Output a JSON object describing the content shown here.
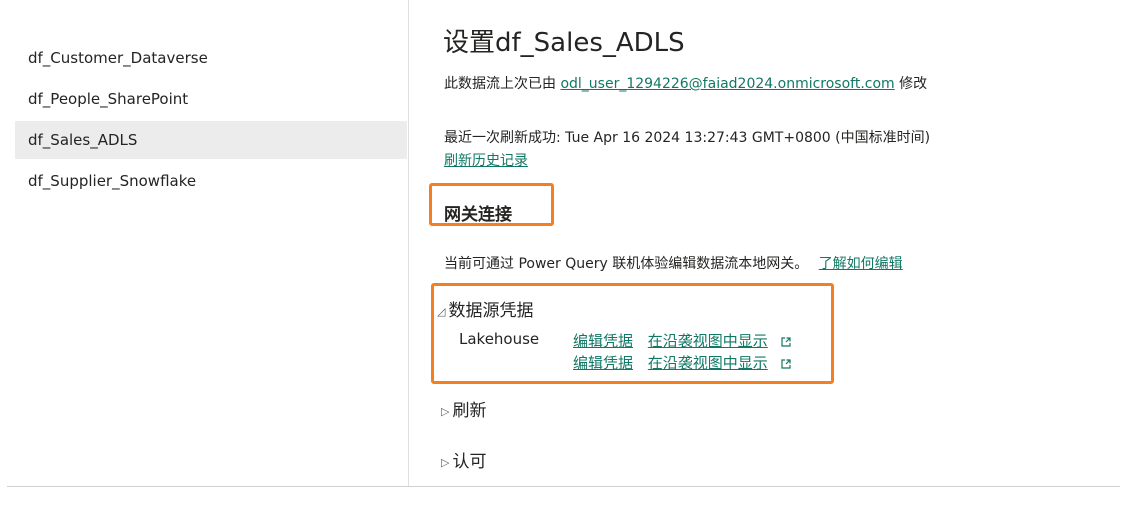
{
  "sidebar": {
    "items": [
      {
        "label": "df_Customer_Dataverse"
      },
      {
        "label": "df_People_SharePoint"
      },
      {
        "label": "df_Sales_ADLS"
      },
      {
        "label": "df_Supplier_Snowflake"
      }
    ]
  },
  "main": {
    "title": "设置df_Sales_ADLS",
    "modified_prefix": "此数据流上次已由",
    "modified_user": "odl_user_1294226@faiad2024.onmicrosoft.com",
    "modified_suffix": "修改",
    "refresh_status": "最近一次刷新成功: Tue Apr 16 2024 13:27:43 GMT+0800 (中国标准时间)",
    "refresh_history_link": "刷新历史记录",
    "gateway": {
      "heading": "网关连接",
      "description": "当前可通过 Power Query 联机体验编辑数据流本地网关。",
      "learn_link": "了解如何编辑"
    },
    "data_source_credentials": {
      "heading": "数据源凭据",
      "source_name": "Lakehouse",
      "rows": [
        {
          "edit_label": "编辑凭据",
          "lineage_label": "在沿袭视图中显示"
        },
        {
          "edit_label": "编辑凭据",
          "lineage_label": "在沿袭视图中显示"
        }
      ]
    },
    "refresh_section": "刷新",
    "endorsement_section": "认可"
  },
  "colors": {
    "link": "#117865",
    "highlight": "#f47f1e",
    "selected_bg": "#ececec"
  },
  "icons": {
    "expanded": "▲ (expanded triangle)",
    "collapsed": "▷",
    "external_link": "external-link-icon"
  }
}
